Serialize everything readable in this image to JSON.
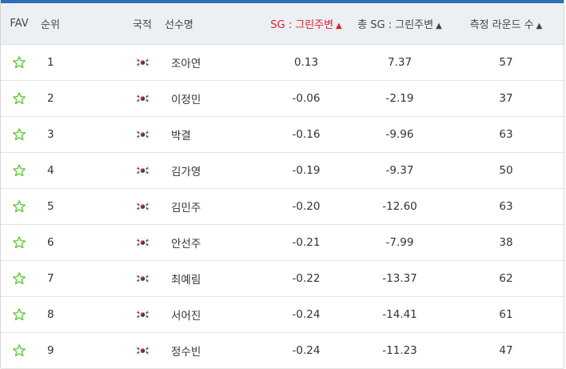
{
  "header": {
    "fav": "FAV",
    "rank": "순위",
    "nationality": "국적",
    "player": "선수명",
    "sg_around_green": "SG : 그린주변",
    "total_sg_around_green": "총 SG : 그린주변",
    "rounds": "측정 라운드 수",
    "sort_desc_glyph": "▲",
    "sort_asc_glyph": "▲"
  },
  "colors": {
    "sorted_header": "#e21e2a",
    "star_outline": "#4cc21a",
    "header_bg": "#ecf0f4",
    "accent_topline": "#2c6fb3"
  },
  "rows": [
    {
      "rank": "1",
      "nationality_icon": "korea-flag-icon",
      "player": "조아연",
      "sg": "0.13",
      "total_sg": "7.37",
      "rounds": "57"
    },
    {
      "rank": "2",
      "nationality_icon": "korea-flag-icon",
      "player": "이정민",
      "sg": "-0.06",
      "total_sg": "-2.19",
      "rounds": "37"
    },
    {
      "rank": "3",
      "nationality_icon": "korea-flag-icon",
      "player": "박결",
      "sg": "-0.16",
      "total_sg": "-9.96",
      "rounds": "63"
    },
    {
      "rank": "4",
      "nationality_icon": "korea-flag-icon",
      "player": "김가영",
      "sg": "-0.19",
      "total_sg": "-9.37",
      "rounds": "50"
    },
    {
      "rank": "5",
      "nationality_icon": "korea-flag-icon",
      "player": "김민주",
      "sg": "-0.20",
      "total_sg": "-12.60",
      "rounds": "63"
    },
    {
      "rank": "6",
      "nationality_icon": "korea-flag-icon",
      "player": "안선주",
      "sg": "-0.21",
      "total_sg": "-7.99",
      "rounds": "38"
    },
    {
      "rank": "7",
      "nationality_icon": "korea-flag-icon",
      "player": "최예림",
      "sg": "-0.22",
      "total_sg": "-13.37",
      "rounds": "62"
    },
    {
      "rank": "8",
      "nationality_icon": "korea-flag-icon",
      "player": "서어진",
      "sg": "-0.24",
      "total_sg": "-14.41",
      "rounds": "61"
    },
    {
      "rank": "9",
      "nationality_icon": "korea-flag-icon",
      "player": "정수빈",
      "sg": "-0.24",
      "total_sg": "-11.23",
      "rounds": "47"
    }
  ]
}
